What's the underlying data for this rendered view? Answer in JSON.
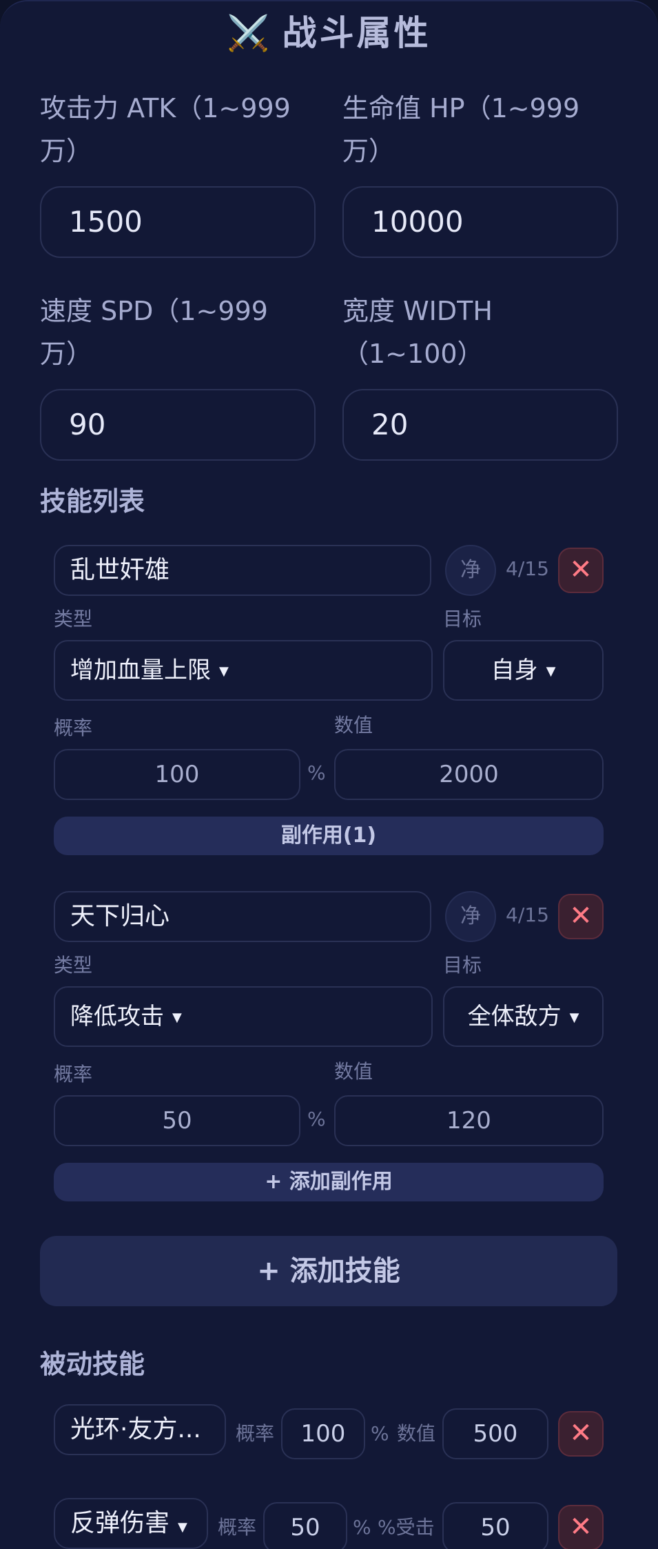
{
  "header": {
    "icon": "⚔️",
    "title": "战斗属性"
  },
  "stats": {
    "atk": {
      "label": "攻击力 ATK（1~999万）",
      "value": "1500"
    },
    "hp": {
      "label": "生命值 HP（1~999万）",
      "value": "10000"
    },
    "spd": {
      "label": "速度 SPD（1~999万）",
      "value": "90"
    },
    "width": {
      "label": "宽度 WIDTH（1~100）",
      "value": "20"
    }
  },
  "skills_title": "技能列表",
  "skills": [
    {
      "name": "乱世奸雄",
      "pure_label": "净",
      "count": "4/15",
      "type_label": "类型",
      "type_value": "增加血量上限",
      "target_label": "目标",
      "target_value": "自身",
      "rate_label": "概率",
      "rate_value": "100",
      "percent": "%",
      "value_label": "数值",
      "value": "2000",
      "side_effect": "副作用(1)"
    },
    {
      "name": "天下归心",
      "pure_label": "净",
      "count": "4/15",
      "type_label": "类型",
      "type_value": "降低攻击",
      "target_label": "目标",
      "target_value": "全体敌方",
      "rate_label": "概率",
      "rate_value": "50",
      "percent": "%",
      "value_label": "数值",
      "value": "120",
      "side_effect": "+ 添加副作用"
    }
  ],
  "add_skill": "+ 添加技能",
  "passive_title": "被动技能",
  "passives": [
    {
      "name": "光环·友方...",
      "rate_label": "概率",
      "rate": "100",
      "percent": "%",
      "value_label": "数值",
      "value": "500"
    },
    {
      "name": "反弹伤害",
      "rate_label": "概率",
      "rate": "50",
      "percent": "%",
      "value_label": "%受击",
      "value": "50"
    }
  ],
  "colors": {
    "background": "#121836",
    "accent": "#252d5a",
    "danger": "#ff7b86"
  }
}
